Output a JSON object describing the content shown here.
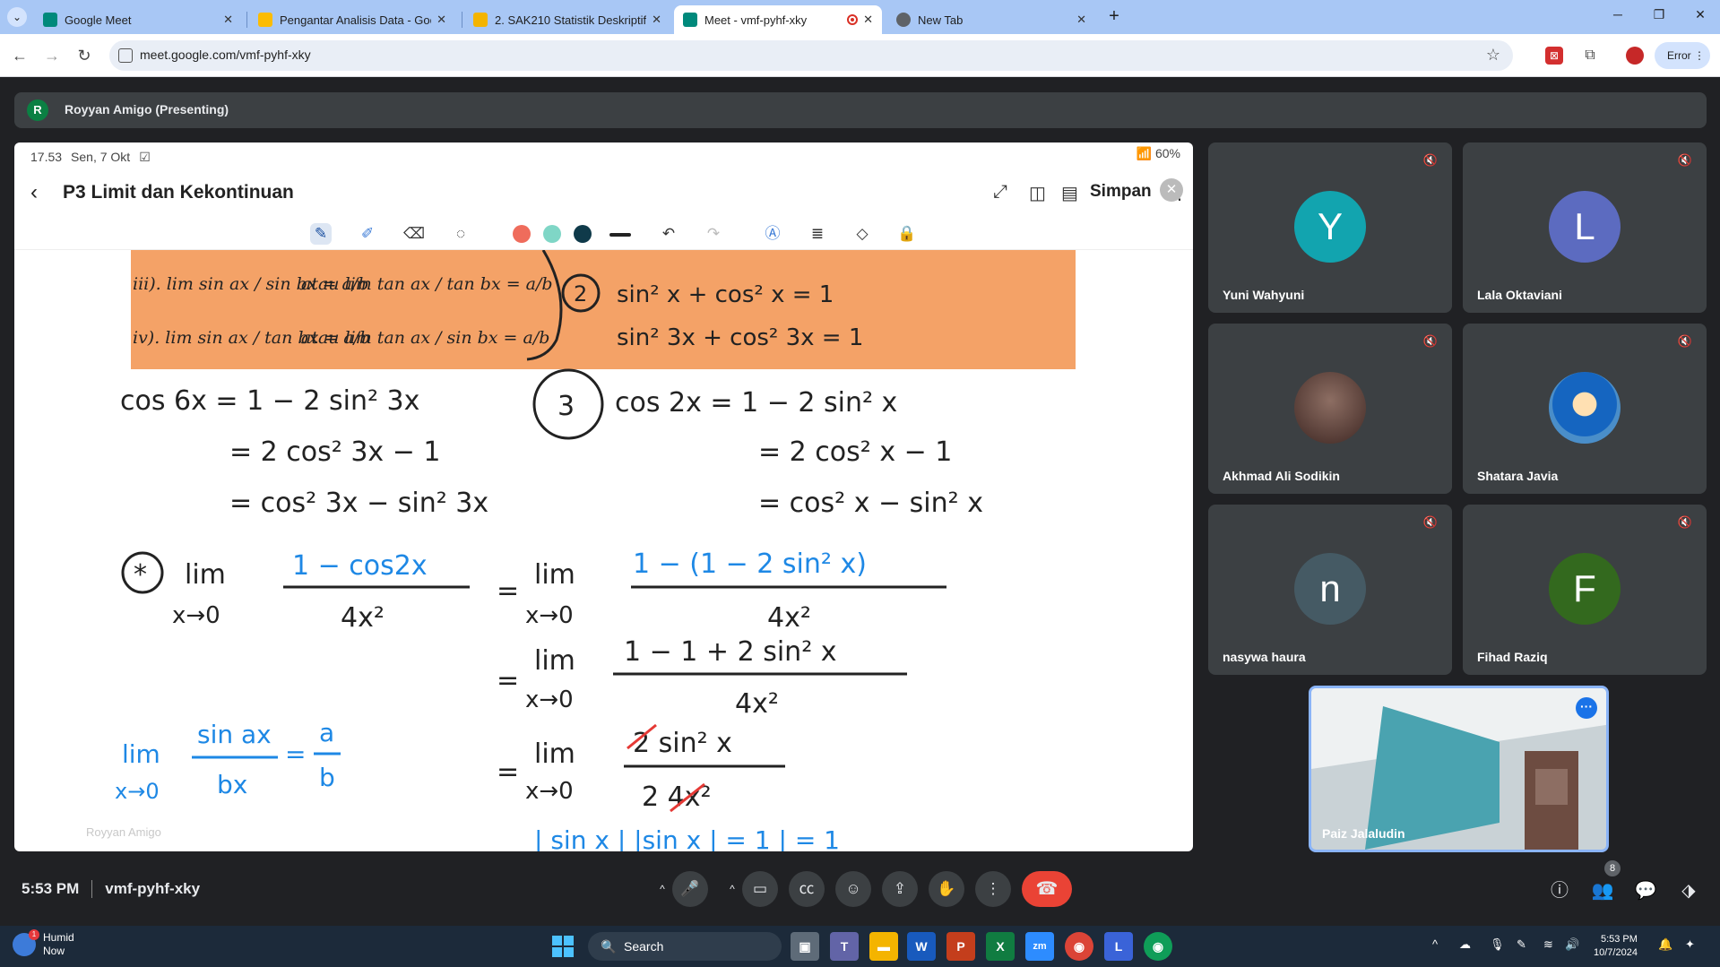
{
  "browser": {
    "tabs": [
      {
        "label": "Google Meet",
        "active": false,
        "fav_color": "#00897b"
      },
      {
        "label": "Pengantar Analisis Data - Goog",
        "active": false,
        "fav_color": "#fbbc04"
      },
      {
        "label": "2. SAK210 Statistik Deskriptif.pp",
        "active": false,
        "fav_color": "#f4b400"
      },
      {
        "label": "Meet - vmf-pyhf-xky",
        "active": true,
        "fav_color": "#00897b"
      },
      {
        "label": "New Tab",
        "active": false,
        "fav_color": "#5f6368"
      }
    ],
    "url": "meet.google.com/vmf-pyhf-xky",
    "profile_label": "Error"
  },
  "meet": {
    "presenter_initial": "R",
    "presenter_label": "Royyan Amigo (Presenting)",
    "time": "5:53 PM",
    "meeting_code": "vmf-pyhf-xky",
    "participant_count": "8",
    "participants": [
      {
        "name": "Yuni Wahyuni",
        "initial": "Y",
        "color": "#12a4af"
      },
      {
        "name": "Lala Oktaviani",
        "initial": "L",
        "color": "#5c6bc0"
      },
      {
        "name": "Akhmad Ali Sodikin",
        "initial": "",
        "color": "#6d4c41"
      },
      {
        "name": "Shatara Javia",
        "initial": "",
        "color": "#4a8ec9"
      },
      {
        "name": "nasywa haura",
        "initial": "n",
        "color": "#455a64"
      },
      {
        "name": "Fihad Raziq",
        "initial": "F",
        "color": "#33691e"
      }
    ],
    "self_name": "Paiz Jalaludin"
  },
  "tablet": {
    "time": "17.53",
    "date": "Sen, 7 Okt",
    "battery": "60%",
    "note_title": "P3 Limit dan Kekontinuan",
    "save_label": "Simpan",
    "watermark": "Royyan Amigo",
    "pen_colors": [
      "#ef6c5c",
      "#7fd6c6",
      "#0f3a4a"
    ]
  },
  "notes": {
    "formula_iii_lhs": "iii). lim sin ax / sin bx = a/b",
    "formula_iii_rhs": "atau lim tan ax / tan bx = a/b",
    "formula_iv_lhs": "iv). lim sin ax / tan bx = a/b",
    "formula_iv_rhs": "atau lim tan ax / sin bx = a/b",
    "atau": "atau",
    "identity_num": "2",
    "identity_1": "sin² x + cos² x = 1",
    "identity_2": "sin² 3x + cos² 3x = 1",
    "cos6x_1": "cos 6x = 1 − 2 sin² 3x",
    "cos6x_2": "= 2 cos² 3x − 1",
    "cos6x_3": "= cos² 3x − sin² 3x",
    "identity3_num": "3",
    "cos2x_1": "cos 2x = 1 − 2 sin² x",
    "cos2x_2": "= 2 cos² x − 1",
    "cos2x_3": "= cos² x − sin² x",
    "limit_star": "*",
    "lim_text": "lim",
    "x_to_0": "x→0",
    "lim1_num": "1 − cos2x",
    "lim1_den": "4x²",
    "lim2_num": "1 − (1 − 2 sin² x)",
    "lim2_den": "4x²",
    "lim3_num": "1 − 1 + 2 sin² x",
    "lim3_den": "4x²",
    "lim4_num": "2 sin² x",
    "lim4_den": "2 4x²",
    "side_num": "sin ax",
    "side_den": "bx",
    "side_a": "a",
    "side_b": "b",
    "bottom_partial": "| sin x |  |sin x |  = 1   | = 1"
  },
  "taskbar": {
    "weather_label": "Humid",
    "weather_sub": "Now",
    "weather_badge": "1",
    "search_label": "Search",
    "clock_time": "5:53 PM",
    "clock_date": "10/7/2024"
  }
}
